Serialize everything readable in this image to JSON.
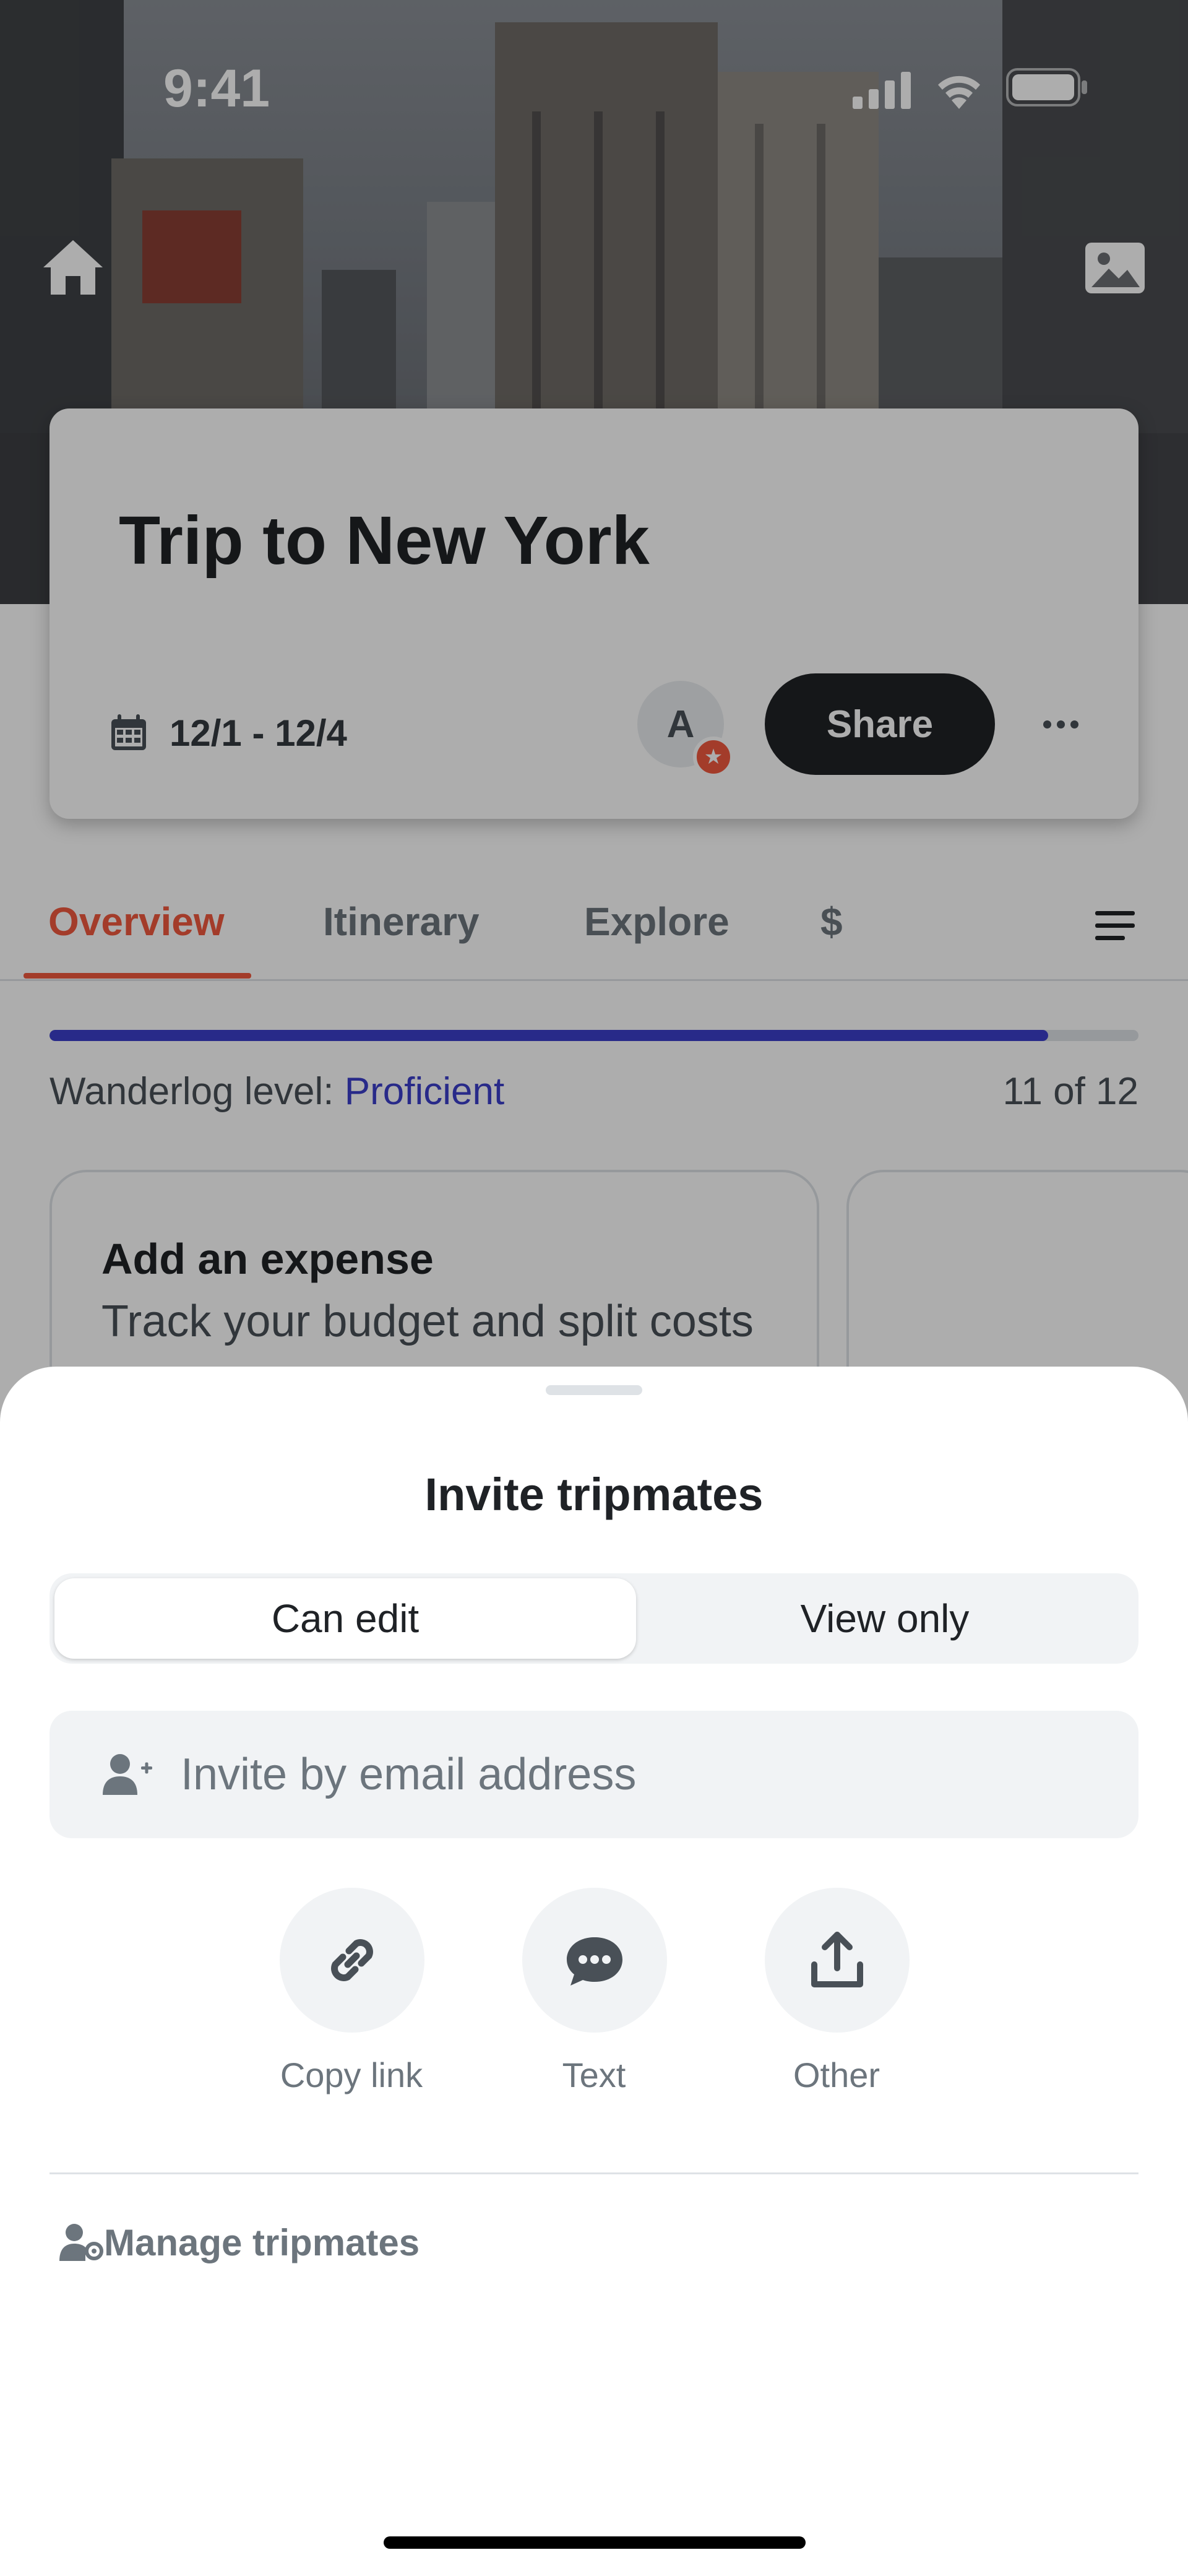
{
  "status_bar": {
    "time": "9:41"
  },
  "trip": {
    "title": "Trip to New York",
    "dates": "12/1 - 12/4",
    "avatar_initial": "A",
    "share_label": "Share"
  },
  "tabs": [
    {
      "label": "Overview",
      "active": true
    },
    {
      "label": "Itinerary",
      "active": false
    },
    {
      "label": "Explore",
      "active": false
    },
    {
      "label": "$",
      "active": false
    }
  ],
  "progress": {
    "level_label": "Wanderlog level:",
    "level_value": "Proficient",
    "count_text": "11 of 12",
    "fraction": 0.917
  },
  "cards": {
    "expense_title": "Add an expense",
    "expense_subtitle": "Track your budget and split costs"
  },
  "sheet": {
    "title": "Invite tripmates",
    "segments": {
      "edit": "Can edit",
      "view": "View only",
      "selected": "edit"
    },
    "email_placeholder": "Invite by email address",
    "share_options": [
      {
        "label": "Copy link",
        "icon": "link-icon"
      },
      {
        "label": "Text",
        "icon": "chat-icon"
      },
      {
        "label": "Other",
        "icon": "upload-icon"
      }
    ],
    "manage_label": "Manage tripmates"
  },
  "colors": {
    "accent": "#f0593e",
    "progress": "#3b3fcb",
    "dark": "#1f2226"
  }
}
